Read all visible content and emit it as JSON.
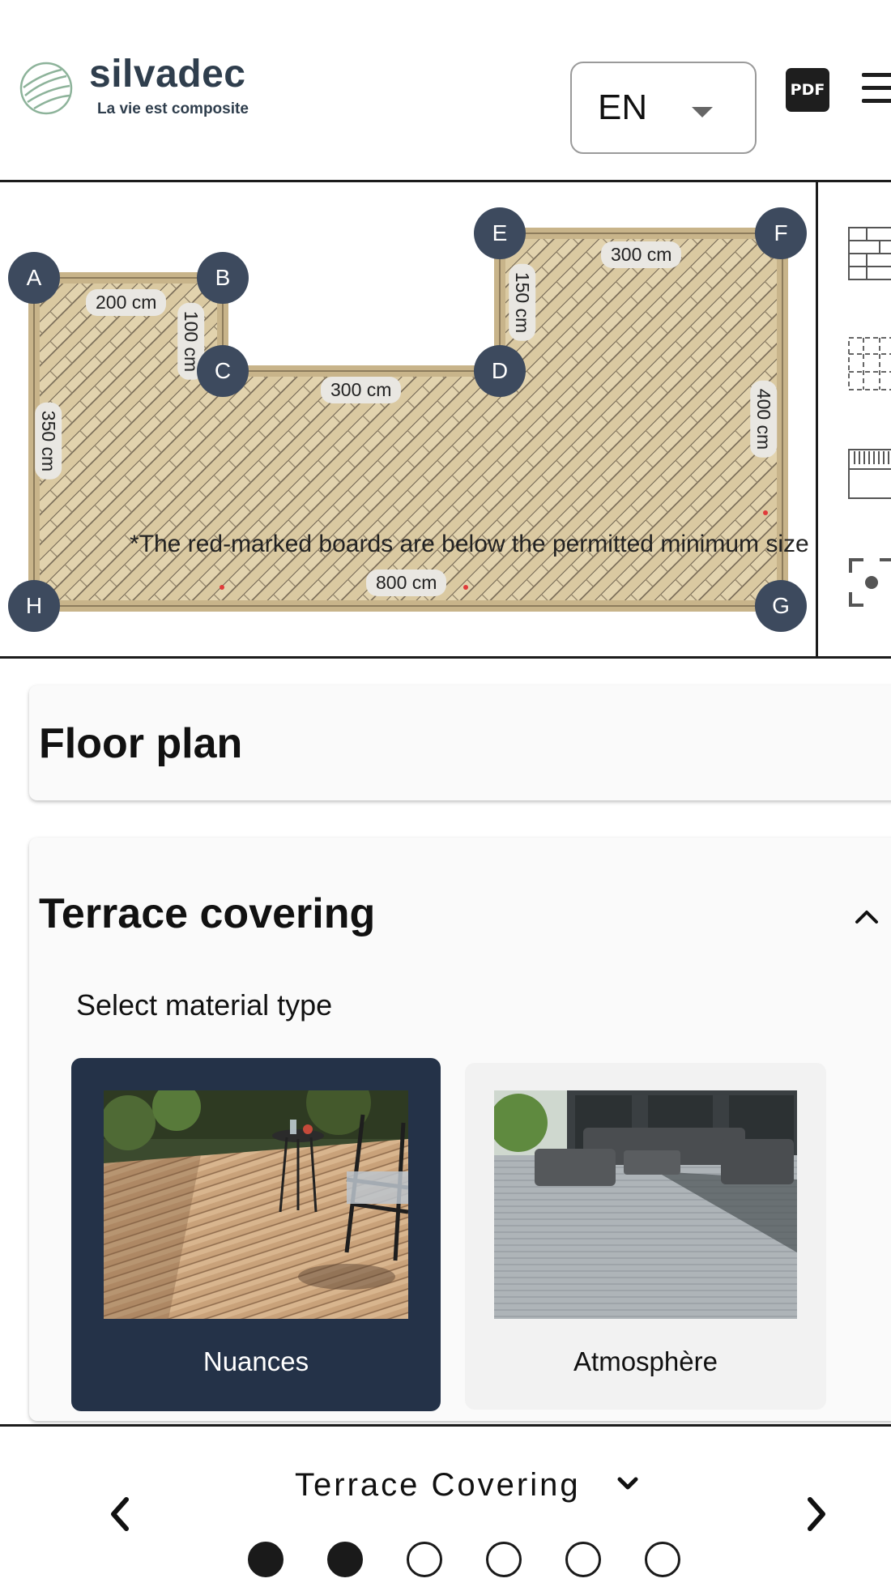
{
  "header": {
    "brand_name": "silvadec",
    "brand_tagline": "La vie est composite",
    "language": "EN",
    "pdf_label": "PDF"
  },
  "plan": {
    "corners": [
      "A",
      "B",
      "C",
      "D",
      "E",
      "F",
      "G",
      "H"
    ],
    "dimensions": {
      "ab": "200 cm",
      "bc": "100 cm",
      "cd": "300 cm",
      "de": "150 cm",
      "ef": "300 cm",
      "fg": "400 cm",
      "gh": "800 cm",
      "ha": "350 cm"
    },
    "warning": "*The red-marked boards are below the permitted minimum size"
  },
  "floor_plan": {
    "title": "Floor plan"
  },
  "terrace_covering": {
    "title": "Terrace covering",
    "select_label": "Select material type",
    "materials": [
      {
        "label": "Nuances",
        "selected": true
      },
      {
        "label": "Atmosphère",
        "selected": false
      }
    ]
  },
  "footer": {
    "step_title": "Terrace Covering",
    "steps_total": 6,
    "steps_completed": 2
  },
  "colors": {
    "brand_dark": "#2f3e4d",
    "selected_card": "#243248",
    "corner_marker": "#3d4a5e",
    "deck_wood": "#d9c7a0"
  }
}
